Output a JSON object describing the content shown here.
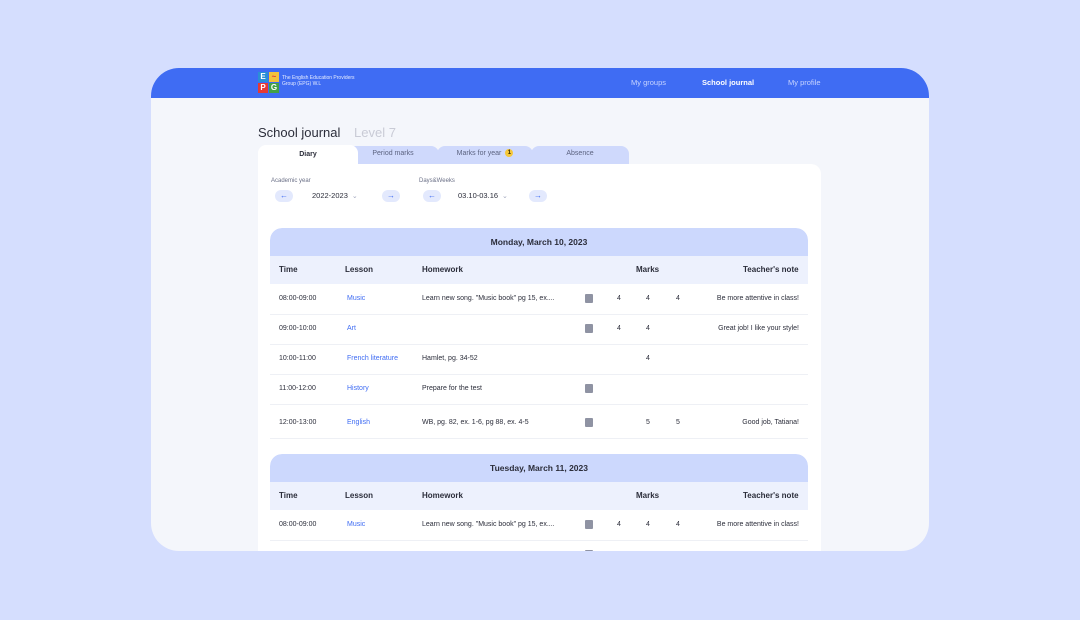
{
  "app": {
    "logo_letters": [
      "E",
      "P",
      "G"
    ],
    "logo_text": "The English Education Providers Group (EPG) W.L"
  },
  "nav": {
    "items": [
      {
        "label": "My groups",
        "active": false
      },
      {
        "label": "School journal",
        "active": true
      },
      {
        "label": "My profile",
        "active": false
      }
    ]
  },
  "page": {
    "title": "School journal",
    "subtitle": "Level 7"
  },
  "tabs": [
    {
      "label": "Diary",
      "active": true
    },
    {
      "label": "Period marks",
      "active": false
    },
    {
      "label": "Marks for year",
      "active": false,
      "badge": "1"
    },
    {
      "label": "Absence",
      "active": false
    }
  ],
  "filters": {
    "year": {
      "label": "Academic year",
      "value": "2022-2023"
    },
    "days": {
      "label": "Days&Weeks",
      "value": "03.10-03.16"
    }
  },
  "columns": {
    "time": "Time",
    "lesson": "Lesson",
    "homework": "Homework",
    "marks": "Marks",
    "note": "Teacher's note"
  },
  "days": [
    {
      "title": "Monday, March 10, 2023",
      "rows": [
        {
          "time": "08:00-09:00",
          "lesson": "Music",
          "homework": "Learn new song. \"Music book\" pg 15, ex....",
          "doc": true,
          "marks": [
            "4",
            "4",
            "4"
          ],
          "note": "Be more attentive in class!"
        },
        {
          "time": "09:00-10:00",
          "lesson": "Art",
          "homework": "",
          "doc": true,
          "marks": [
            "4",
            "4",
            ""
          ],
          "note": "Great job! I like your style!"
        },
        {
          "time": "10:00-11:00",
          "lesson": "French literature",
          "homework": "Hamlet, pg. 34-52",
          "doc": false,
          "marks": [
            "",
            "4",
            ""
          ],
          "note": ""
        },
        {
          "time": "11:00-12:00",
          "lesson": "History",
          "homework": "Prepare for the test",
          "doc": true,
          "marks": [
            "",
            "",
            ""
          ],
          "note": ""
        },
        {
          "time": "12:00-13:00",
          "lesson": "English",
          "homework": "WB, pg. 82, ex. 1-6, pg 88, ex. 4-5",
          "doc": true,
          "marks": [
            "",
            "5",
            "5"
          ],
          "note": "Good job, Tatiana!"
        }
      ]
    },
    {
      "title": "Tuesday, March 11, 2023",
      "rows": [
        {
          "time": "08:00-09:00",
          "lesson": "Music",
          "homework": "Learn new song. \"Music book\" pg 15, ex....",
          "doc": true,
          "marks": [
            "4",
            "4",
            "4"
          ],
          "note": "Be more attentive in class!"
        }
      ]
    }
  ],
  "colors": {
    "accent": "#3f6cf3",
    "background": "#d5defe",
    "day_header": "#ccd8fd",
    "badge": "#f5c73b"
  }
}
